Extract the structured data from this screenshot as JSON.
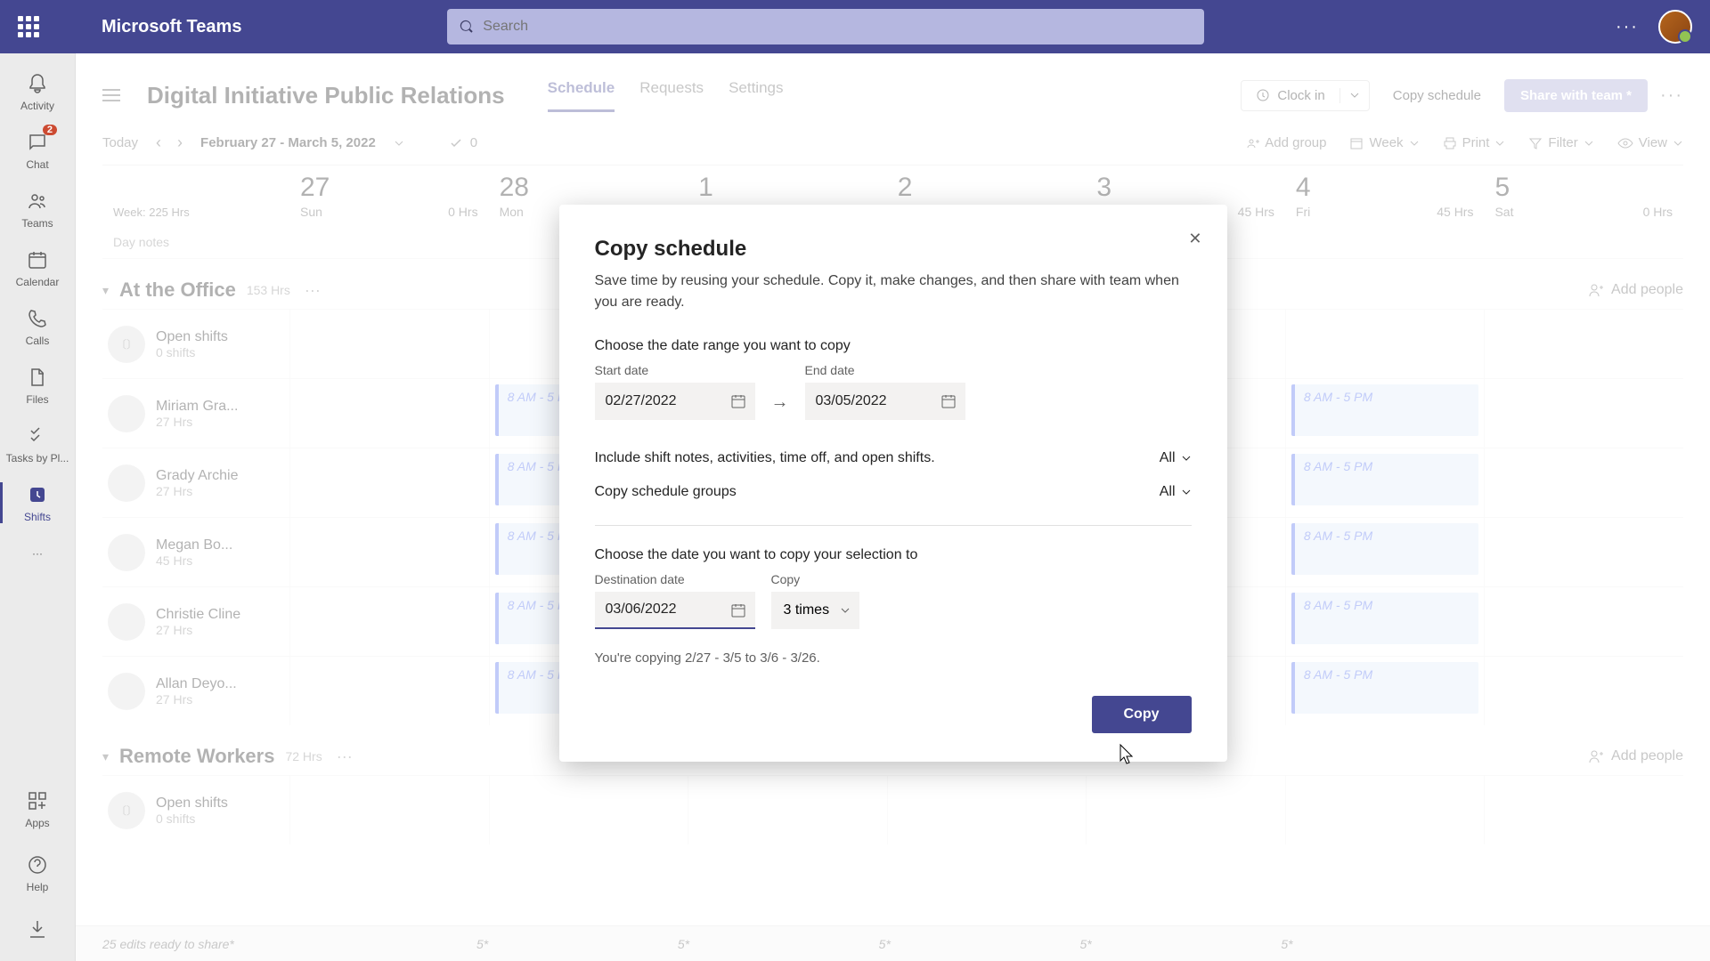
{
  "app": {
    "name": "Microsoft Teams",
    "search_placeholder": "Search"
  },
  "rail": {
    "activity": "Activity",
    "chat": "Chat",
    "chat_badge": "2",
    "teams": "Teams",
    "calendar": "Calendar",
    "calls": "Calls",
    "files": "Files",
    "tasks": "Tasks by Pl...",
    "shifts": "Shifts",
    "apps": "Apps",
    "help": "Help"
  },
  "header": {
    "title": "Digital Initiative Public Relations",
    "tabs": {
      "schedule": "Schedule",
      "requests": "Requests",
      "settings": "Settings"
    },
    "clock_in": "Clock in",
    "copy_schedule": "Copy schedule",
    "share": "Share with team *"
  },
  "toolbar": {
    "today": "Today",
    "range": "February 27 - March 5, 2022",
    "checked_count": "0",
    "add_group": "Add group",
    "week": "Week",
    "print": "Print",
    "filter": "Filter",
    "view": "View"
  },
  "days": {
    "week_total": "Week: 225 Hrs",
    "cols": [
      {
        "num": "27",
        "dow": "Sun",
        "hrs": "0 Hrs"
      },
      {
        "num": "28",
        "dow": "Mon",
        "hrs": ""
      },
      {
        "num": "1",
        "dow": "",
        "hrs": ""
      },
      {
        "num": "2",
        "dow": "",
        "hrs": ""
      },
      {
        "num": "3",
        "dow": "",
        "hrs": "45 Hrs"
      },
      {
        "num": "4",
        "dow": "Fri",
        "hrs": "45 Hrs"
      },
      {
        "num": "5",
        "dow": "Sat",
        "hrs": "0 Hrs"
      }
    ],
    "notes": "Day notes"
  },
  "groups": [
    {
      "name": "At the Office",
      "hrs": "153 Hrs",
      "rows": [
        {
          "name": "Open shifts",
          "sub": "0 shifts",
          "open": true
        },
        {
          "name": "Miriam Gra...",
          "sub": "27 Hrs"
        },
        {
          "name": "Grady Archie",
          "sub": "27 Hrs"
        },
        {
          "name": "Megan Bo...",
          "sub": "45 Hrs"
        },
        {
          "name": "Christie Cline",
          "sub": "27 Hrs"
        },
        {
          "name": "Allan Deyo...",
          "sub": "27 Hrs"
        }
      ]
    },
    {
      "name": "Remote Workers",
      "hrs": "72 Hrs",
      "rows": [
        {
          "name": "Open shifts",
          "sub": "0 shifts",
          "open": true
        }
      ]
    }
  ],
  "shift_label": "8 AM - 5 PM",
  "add_people": "Add people",
  "footer": {
    "left": "25 edits ready to share*",
    "cell": "5*"
  },
  "modal": {
    "title": "Copy schedule",
    "subtitle": "Save time by reusing your schedule. Copy it, make changes, and then share with team when you are ready.",
    "range_label": "Choose the date range you want to copy",
    "start_label": "Start date",
    "start_value": "02/27/2022",
    "end_label": "End date",
    "end_value": "03/05/2022",
    "include_label": "Include shift notes, activities, time off, and open shifts.",
    "include_value": "All",
    "groups_label": "Copy schedule groups",
    "groups_value": "All",
    "dest_heading": "Choose the date you want to copy your selection to",
    "dest_label": "Destination date",
    "dest_value": "03/06/2022",
    "copy_label": "Copy",
    "copy_times": "3 times",
    "summary": "You're copying 2/27 - 3/5 to 3/6 - 3/26.",
    "button": "Copy"
  }
}
